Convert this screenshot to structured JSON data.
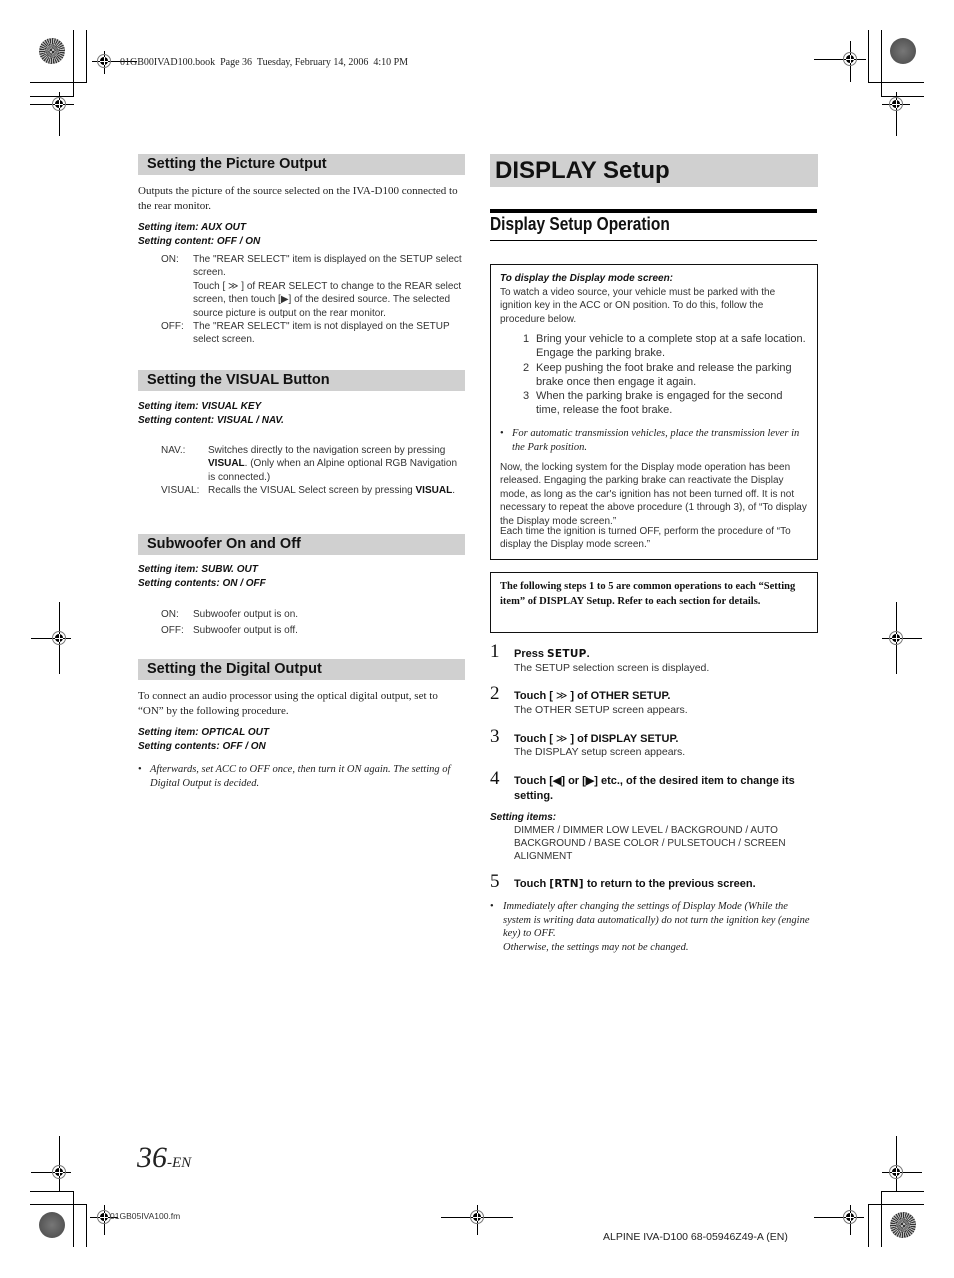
{
  "print_header": "01GB00IVAD100.book  Page 36  Tuesday, February 14, 2006  4:10 PM",
  "left_column": {
    "picture_output": {
      "heading": "Setting the Picture Output",
      "intro": "Outputs the picture of the source selected on the IVA-D100 connected to the rear monitor.",
      "setting_item": "Setting item: AUX OUT",
      "setting_content": "Setting content: OFF / ON",
      "options": [
        {
          "term": "ON:",
          "lines": [
            "The \"REAR SELECT\" item is displayed on the SETUP select screen.",
            "Touch [ ≫ ] of REAR SELECT to change to the REAR select screen, then touch [▶] of the desired source. The selected source picture is output on the rear monitor."
          ]
        },
        {
          "term": "OFF:",
          "lines": [
            "The \"REAR SELECT\" item is not displayed on the SETUP select screen."
          ]
        }
      ]
    },
    "visual_button": {
      "heading": "Setting the VISUAL Button",
      "setting_item": "Setting item: VISUAL KEY",
      "setting_content": "Setting content: VISUAL / NAV.",
      "options": [
        {
          "term": "NAV.:",
          "pre": "Switches directly to the navigation screen by pressing ",
          "key": "VISUAL",
          "post": ". (Only when an Alpine optional RGB Navigation is connected.)"
        },
        {
          "term": "VISUAL:",
          "pre": "Recalls the VISUAL Select screen by pressing ",
          "key": "VISUAL",
          "post": "."
        }
      ]
    },
    "subwoofer": {
      "heading": "Subwoofer On and Off",
      "setting_item": "Setting item: SUBW. OUT",
      "setting_content": "Setting contents: ON / OFF",
      "options": [
        {
          "term": "ON:",
          "desc": "Subwoofer output is on."
        },
        {
          "term": "OFF:",
          "desc": "Subwoofer output is off."
        }
      ]
    },
    "digital_output": {
      "heading": "Setting the Digital Output",
      "intro": "To connect an audio processor using the optical digital output, set to “ON” by the following procedure.",
      "setting_item": "Setting item: OPTICAL OUT",
      "setting_content": "Setting contents: OFF / ON",
      "note": "Afterwards, set ACC to OFF once, then turn it ON again. The setting of Digital Output is decided."
    }
  },
  "right_column": {
    "title": "DISPLAY Setup",
    "subtitle": "Display Setup Operation",
    "info_box": {
      "heading": "To display the Display mode screen:",
      "intro": "To watch a video source, your vehicle must be parked with the ignition key in the ACC or ON position. To do this, follow the procedure below.",
      "steps": [
        {
          "num": "1",
          "text": "Bring your vehicle to a complete stop at a safe location. Engage the parking brake."
        },
        {
          "num": "2",
          "text": "Keep pushing the foot brake and release the parking brake once then engage it again."
        },
        {
          "num": "3",
          "text": "When the parking brake is engaged for the second time, release the foot brake."
        }
      ],
      "note": "For automatic transmission vehicles, place the transmission lever in the Park position.",
      "para1": "Now, the locking system for the Display mode operation has been released. Engaging the parking brake can reactivate the Display mode, as long as the car's ignition has not been turned off.  It is not necessary to repeat the above procedure (1 through 3),  of “To display the Display mode screen.”",
      "para2": "Each time the ignition is turned OFF, perform the procedure of “To display the Display mode screen.”"
    },
    "common_box": "The following steps 1 to 5 are common operations to each “Setting item” of DISPLAY Setup.  Refer to each section for details.",
    "steps": [
      {
        "num": "1",
        "pre": "Press ",
        "key": "SETUP",
        "post": ".",
        "desc": "The SETUP selection screen is displayed."
      },
      {
        "num": "2",
        "pre": "Touch [",
        "glyph": "≫",
        "post": "] of OTHER SETUP.",
        "desc": "The OTHER SETUP screen appears."
      },
      {
        "num": "3",
        "pre": "Touch [",
        "glyph": "≫",
        "post": "] of DISPLAY SETUP.",
        "desc": "The DISPLAY setup screen appears."
      },
      {
        "num": "4",
        "text": "Touch [◀] or [▶] etc., of the desired item to change its setting."
      },
      {
        "num": "5",
        "pre": "Touch ",
        "key": "[RTN]",
        "post": " to return to the previous screen."
      }
    ],
    "setting_items_label": "Setting items:",
    "setting_items": "DIMMER / DIMMER LOW LEVEL / BACKGROUND / AUTO BACKGROUND / BASE COLOR / PULSETOUCH / SCREEN ALIGNMENT",
    "final_note_1": "Immediately after changing the settings of Display Mode  (While the system is writing data automatically) do not turn the ignition key (engine key) to OFF.",
    "final_note_2": "Otherwise, the settings may not be changed."
  },
  "footer": {
    "page_number": "36",
    "page_suffix": "-EN",
    "file_name": "01GB05IVA100.fm",
    "model_code": "ALPINE IVA-D100 68-05946Z49-A (EN)"
  }
}
